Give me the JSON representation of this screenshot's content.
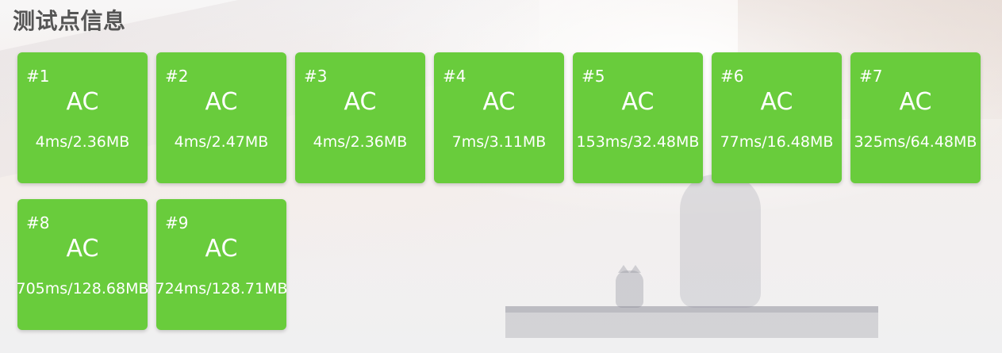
{
  "section": {
    "title": "测试点信息"
  },
  "theme": {
    "tile_color": "#69cc3c",
    "text_color": "#ffffff",
    "title_color": "#555555"
  },
  "test_cases": [
    {
      "id": "#1",
      "status": "AC",
      "usage": "4ms/2.36MB"
    },
    {
      "id": "#2",
      "status": "AC",
      "usage": "4ms/2.47MB"
    },
    {
      "id": "#3",
      "status": "AC",
      "usage": "4ms/2.36MB"
    },
    {
      "id": "#4",
      "status": "AC",
      "usage": "7ms/3.11MB"
    },
    {
      "id": "#5",
      "status": "AC",
      "usage": "153ms/32.48MB"
    },
    {
      "id": "#6",
      "status": "AC",
      "usage": "77ms/16.48MB"
    },
    {
      "id": "#7",
      "status": "AC",
      "usage": "325ms/64.48MB"
    },
    {
      "id": "#8",
      "status": "AC",
      "usage": "705ms/128.68MB"
    },
    {
      "id": "#9",
      "status": "AC",
      "usage": "724ms/128.71MB"
    }
  ]
}
